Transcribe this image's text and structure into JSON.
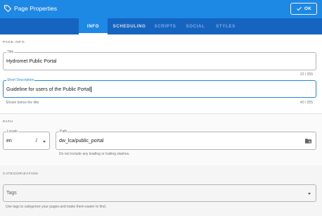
{
  "header": {
    "title": "Page Properties",
    "ok_label": "OK",
    "icon": "tag-icon",
    "colors": {
      "header_bg": "#1e88e5",
      "tabs_bg": "#1565c0"
    }
  },
  "tabs": [
    {
      "label": "INFO",
      "state": "active"
    },
    {
      "label": "SCHEDULING",
      "state": "enabled"
    },
    {
      "label": "SCRIPTS",
      "state": "disabled"
    },
    {
      "label": "SOCIAL",
      "state": "disabled"
    },
    {
      "label": "STYLES",
      "state": "disabled"
    }
  ],
  "info": {
    "section_label": "PAGE INFO",
    "title_field": {
      "label": "Title",
      "value": "Hydromet Public Portal",
      "counter": "22 / 255"
    },
    "description_field": {
      "label": "Short Description",
      "value": "Guideline for users of the Public Portal",
      "hint": "Shown below the title",
      "counter": "40 / 255"
    }
  },
  "path": {
    "section_label": "PATH",
    "locale_field": {
      "label": "Locale",
      "value": "en",
      "separator": "/"
    },
    "path_field": {
      "label": "Path",
      "value": "dw_lca/public_portal",
      "hint": "Do not include any leading or trailing slashes.",
      "icon": "folder-search-icon"
    }
  },
  "categorization": {
    "section_label": "CATEGORIZATION",
    "tags_field": {
      "placeholder": "Tags",
      "hint": "Use tags to categorize your pages and make them easier to find."
    }
  }
}
